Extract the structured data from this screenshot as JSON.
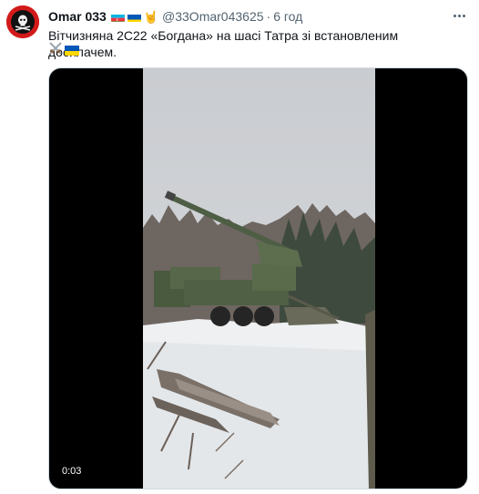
{
  "tweet": {
    "author_name": "Omar 033",
    "handle": "@33Omar043625",
    "separator": "·",
    "time": "6 год",
    "text": "Вітчизняна 2С22 «Богдана» на шасі Татра зі встановленим досилачем.",
    "header_icons": [
      "azerbaijan-flag-icon",
      "ukraine-flag-icon",
      "sign-of-horns-icon"
    ],
    "text_emojis": [
      "crossed-swords-icon",
      "ukraine-flag-icon"
    ],
    "hand_emoji": "🤘"
  },
  "media": {
    "type": "video",
    "timestamp": "0:03"
  },
  "colors": {
    "text_primary": "#0f1419",
    "text_secondary": "#536471",
    "avatar_bg": "#d21a1a",
    "media_bg": "#000000",
    "border": "#cfd9de"
  }
}
